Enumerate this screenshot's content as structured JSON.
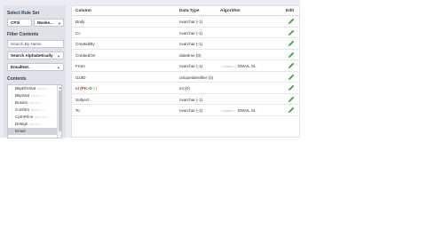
{
  "sidebar": {
    "select_rule_set_title": "Select Rule Set",
    "rule_set_select_left": "CP3i",
    "rule_set_select_right": "Maske...",
    "filter_contents_title": "Filter Contents",
    "search_by_name_placeholder": "Search By Name",
    "sort_select": "Search Alphabetically",
    "type_select": "EmailNot.",
    "contents_title": "Contents",
    "contents_items": [
      {
        "label": "BkpEhrStat"
      },
      {
        "label": "BkpStat"
      },
      {
        "label": "Busine"
      },
      {
        "label": "Confirm"
      },
      {
        "label": "CpmPrice"
      },
      {
        "label": "Design"
      },
      {
        "label": "Email"
      }
    ]
  },
  "table": {
    "headers": {
      "column": "Column",
      "data_type": "Data Type",
      "algorithm": "Algorithm",
      "edit": "Edit"
    },
    "rows": [
      {
        "column": "Body",
        "data_type": "nvarchar (-1)",
        "algorithm": ""
      },
      {
        "column": "Cc",
        "data_type": "nvarchar (-1)",
        "algorithm": ""
      },
      {
        "column": "CreatedBy",
        "data_type": "nvarchar (-1)",
        "algorithm": ""
      },
      {
        "column": "CreatedOn",
        "data_type": "datetime (0)",
        "algorithm": ""
      },
      {
        "column": "From",
        "data_type": "nvarchar (-1)",
        "algorithm": "EMAIL SL"
      },
      {
        "column": "GUID",
        "data_type": "uniqueidentifier (0)",
        "algorithm": ""
      },
      {
        "column": "Id",
        "pk_label": "(PK",
        "pk_mid": "ID",
        "pk_end": "I )",
        "data_type": "int (0)",
        "algorithm": ""
      },
      {
        "column": "Subject",
        "data_type": "nvarchar (-1)",
        "algorithm": ""
      },
      {
        "column": "To",
        "data_type": "nvarchar (-1)",
        "algorithm": "EMAIL SL"
      }
    ]
  },
  "colors": {
    "app_bg": "#eaedf1",
    "sidebar_bg": "#dfe3e9",
    "edit_icon": "#2e9e2e",
    "pk_red": "#c0392b"
  }
}
